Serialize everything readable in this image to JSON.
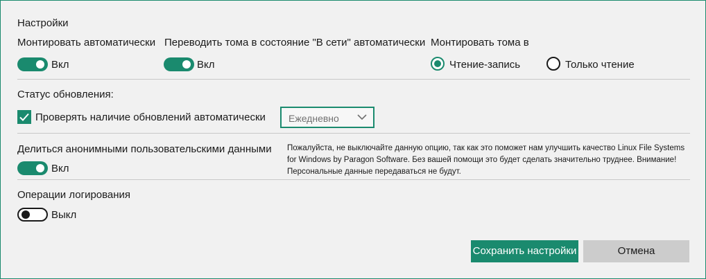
{
  "section_title": "Настройки",
  "auto_mount": {
    "label": "Монтировать автоматически",
    "state": "Вкл"
  },
  "auto_online": {
    "label": "Переводить тома в состояние \"В сети\" автоматически",
    "state": "Вкл"
  },
  "mount_mode": {
    "label": "Монтировать тома в",
    "options": [
      {
        "label": "Чтение-запись",
        "selected": true
      },
      {
        "label": "Только чтение",
        "selected": false
      }
    ]
  },
  "updates": {
    "title": "Статус обновления:",
    "check_label": "Проверять наличие обновлений автоматически",
    "checked": true,
    "frequency": "Ежедневно"
  },
  "anon_data": {
    "label": "Делиться анонимными пользовательскими данными",
    "state": "Вкл",
    "note": "Пожалуйста, не выключайте данную опцию, так как это поможет нам улучшить качество Linux File Systems for Windows by Paragon Software. Без вашей помощи это будет сделать значительно труднее. Внимание! Персональные данные передаваться не будут."
  },
  "logging": {
    "label": "Операции логирования",
    "state": "Выкл"
  },
  "buttons": {
    "save": "Сохранить настройки",
    "cancel": "Отмена"
  },
  "colors": {
    "accent": "#1a8a6e",
    "background": "#f1f1f1",
    "secondary_button": "#cccccc"
  },
  "icons": {
    "check": "checkmark-icon",
    "dropdown": "chevron-down-icon"
  }
}
